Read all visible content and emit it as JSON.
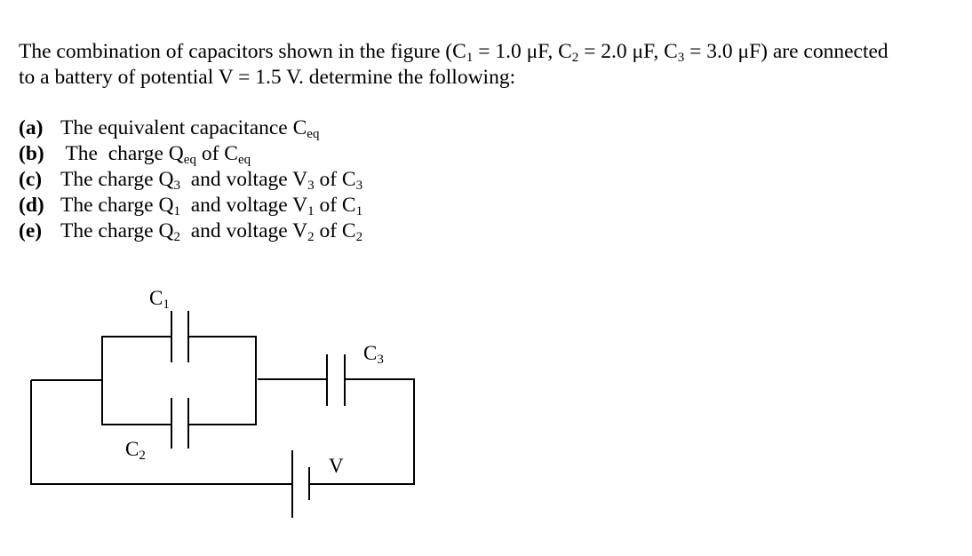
{
  "problem": {
    "intro_line1_a": "The combination of capacitors shown in the figure (C",
    "sub1": "1",
    "intro_line1_b": " = 1.0 μF, C",
    "sub2": "2",
    "intro_line1_c": " = 2.0 μF, C",
    "sub3": "3",
    "intro_line1_d": " = 3.0 μF) are connected",
    "intro_line2": "to a battery of potential V = 1.5 V.  determine the following:"
  },
  "questions": [
    {
      "label": "(a)",
      "text": "The equivalent capacitance C",
      "sub": "eq",
      "rest": ""
    },
    {
      "label": "(b)",
      "text": " The  charge Q",
      "sub": "eq",
      "rest": " of C",
      "sub2": "eq"
    },
    {
      "label": "(c)",
      "text": "The charge Q",
      "sub": "3",
      "rest": "  and voltage V",
      "sub2": "3",
      "rest2": " of C",
      "sub3": "3"
    },
    {
      "label": "(d)",
      "text": "The charge Q",
      "sub": "1",
      "rest": "  and voltage V",
      "sub2": "1",
      "rest2": " of C",
      "sub3": "1"
    },
    {
      "label": "(e)",
      "text": "The charge Q",
      "sub": "2",
      "rest": "  and voltage V",
      "sub2": "2",
      "rest2": " of C",
      "sub3": "2"
    }
  ],
  "circuit": {
    "c1_label": "C",
    "c1_sub": "1",
    "c2_label": "C",
    "c2_sub": "2",
    "c3_label": "C",
    "c3_sub": "3",
    "battery_label": "V",
    "line_color": "#000000"
  }
}
